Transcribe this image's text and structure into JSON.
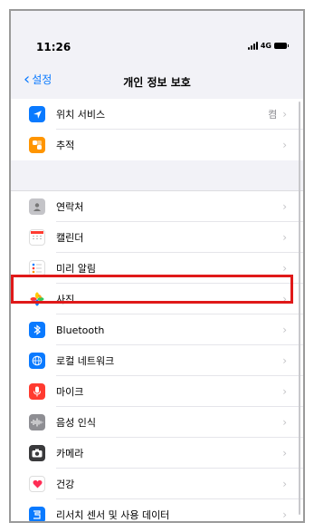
{
  "status": {
    "time": "11:26",
    "network": "4G"
  },
  "nav": {
    "back_label": "설정",
    "title": "개인 정보 보호"
  },
  "group1": [
    {
      "label": "위치 서비스",
      "value": "켬",
      "icon": "location-arrow-icon",
      "color": "#0a7aff"
    },
    {
      "label": "추적",
      "value": "",
      "icon": "tracking-icon",
      "color": "#ff9500"
    }
  ],
  "group2": [
    {
      "label": "연락처",
      "icon": "contacts-icon",
      "color": "#a7a7ac"
    },
    {
      "label": "캘린더",
      "icon": "calendar-icon",
      "color": "#ffffff"
    },
    {
      "label": "미리 알림",
      "icon": "reminders-icon",
      "color": "#ffffff"
    },
    {
      "label": "사진",
      "icon": "photos-icon",
      "color": "#ffffff"
    },
    {
      "label": "Bluetooth",
      "icon": "bluetooth-icon",
      "color": "#0a7aff"
    },
    {
      "label": "로컬 네트워크",
      "icon": "globe-icon",
      "color": "#0a7aff"
    },
    {
      "label": "마이크",
      "icon": "microphone-icon",
      "color": "#ff3b30"
    },
    {
      "label": "음성 인식",
      "icon": "waveform-icon",
      "color": "#8e8e93"
    },
    {
      "label": "카메라",
      "icon": "camera-icon",
      "color": "#3a3a3c"
    },
    {
      "label": "건강",
      "icon": "health-heart-icon",
      "color": "#ffffff"
    },
    {
      "label": "리서치 센서 및 사용 데이터",
      "icon": "research-icon",
      "color": "#0a7aff"
    }
  ],
  "highlight_color": "#e01919"
}
